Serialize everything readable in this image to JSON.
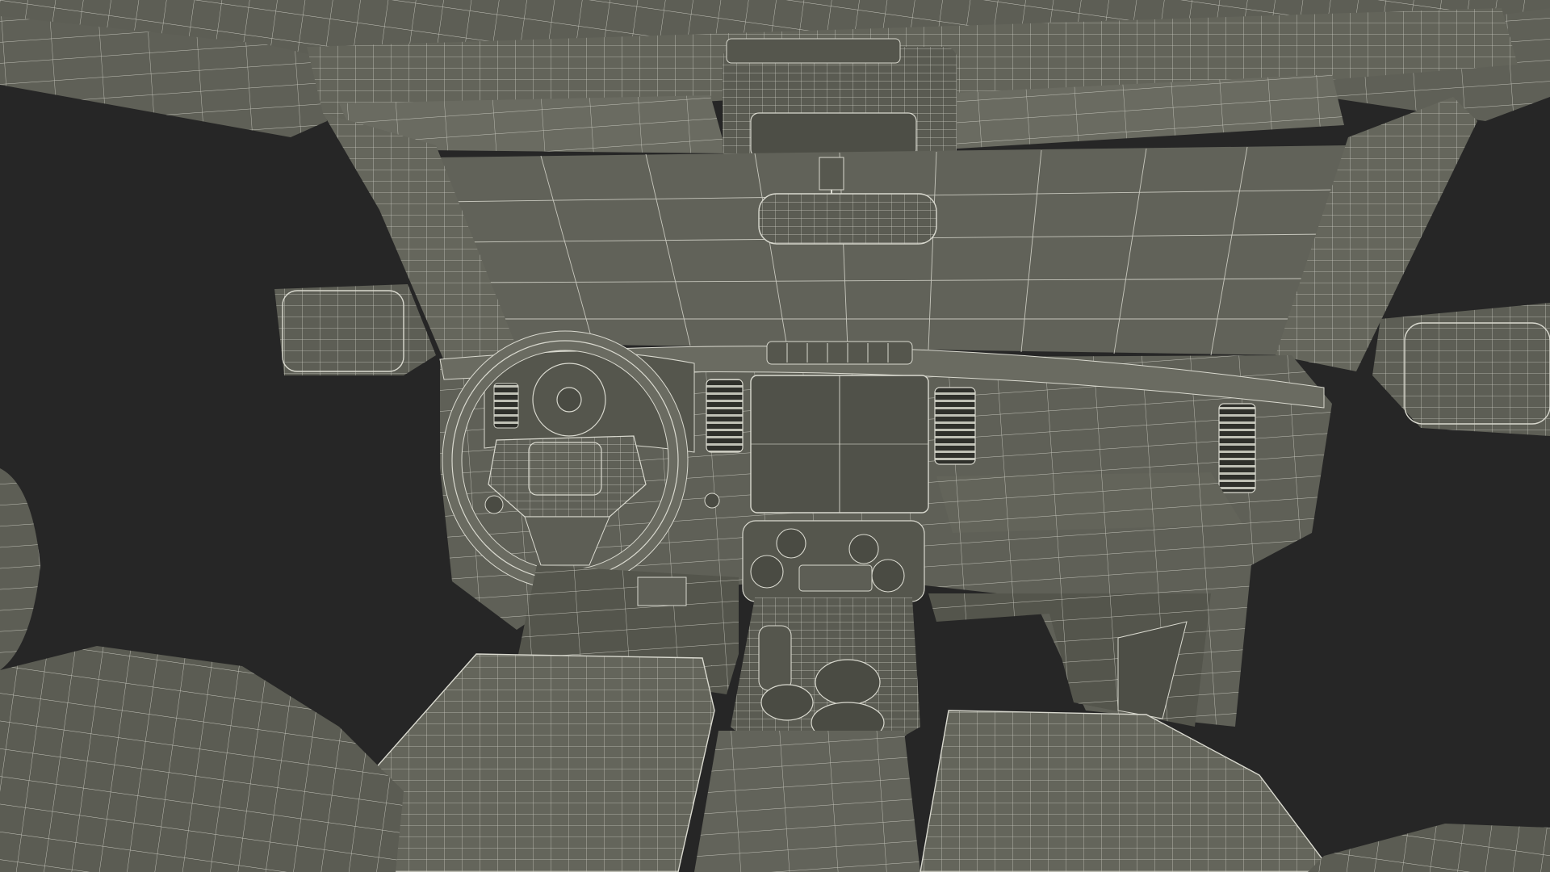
{
  "scene": {
    "background_color": "#262626",
    "mesh_fill_color": "#5d5e55",
    "mesh_fill_light": "#6a6b61",
    "mesh_fill_dark": "#47483f",
    "wireframe_color": "#d9d9cf",
    "opening_color": "#616259"
  }
}
